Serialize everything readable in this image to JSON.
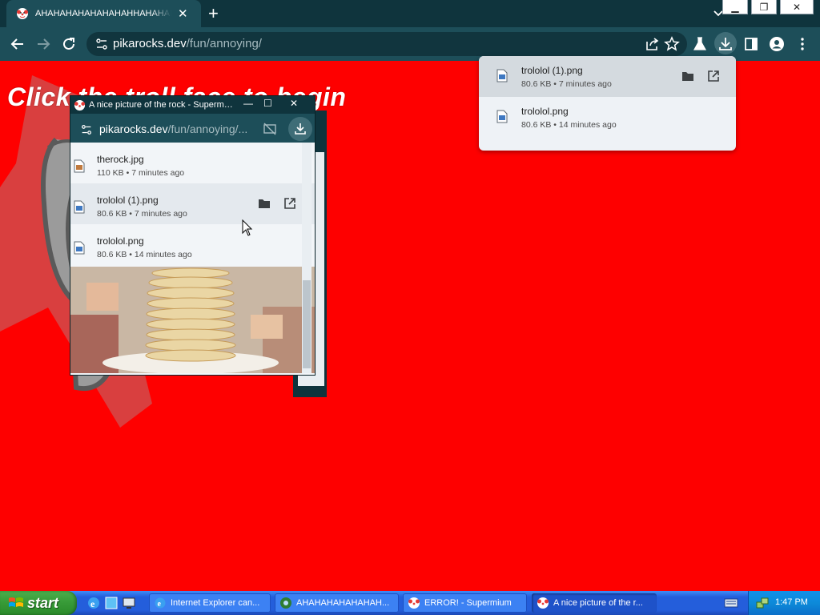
{
  "browser": {
    "tab": {
      "title": "AHAHAHAHAHAHAHAHHAHAHAHAHAHAHA"
    },
    "new_tab": "+",
    "url": {
      "host": "pikarocks.dev",
      "path": "/fun/annoying/"
    }
  },
  "page": {
    "heading": "Click the troll face to begin"
  },
  "downloads_bubble": {
    "items": [
      {
        "name": "trololol (1).png",
        "size": "80.6 KB",
        "time": "7 minutes ago"
      },
      {
        "name": "trololol.png",
        "size": "80.6 KB",
        "time": "14 minutes ago"
      }
    ]
  },
  "popup": {
    "title": "A nice picture of the rock - Supermium",
    "url": {
      "host": "pikarocks.dev",
      "path": "/fun/annoying/..."
    },
    "downloads": [
      {
        "name": "therock.jpg",
        "size": "110 KB",
        "time": "7 minutes ago"
      },
      {
        "name": "trololol (1).png",
        "size": "80.6 KB",
        "time": "7 minutes ago"
      },
      {
        "name": "trololol.png",
        "size": "80.6 KB",
        "time": "14 minutes ago"
      }
    ]
  },
  "taskbar": {
    "start_label": "start",
    "tasks": [
      {
        "label": "Internet Explorer can..."
      },
      {
        "label": "AHAHAHAHAHAHAH..."
      },
      {
        "label": "ERROR! - Supermium"
      },
      {
        "label": "A nice picture of the r..."
      }
    ],
    "clock": "1:47 PM"
  },
  "colors": {
    "page_background": "#fe0000",
    "chrome_dark": "#0f343d",
    "chrome_toolbar": "#1d4e59",
    "xp_taskbar": "#245edb",
    "xp_start": "#379a37"
  }
}
